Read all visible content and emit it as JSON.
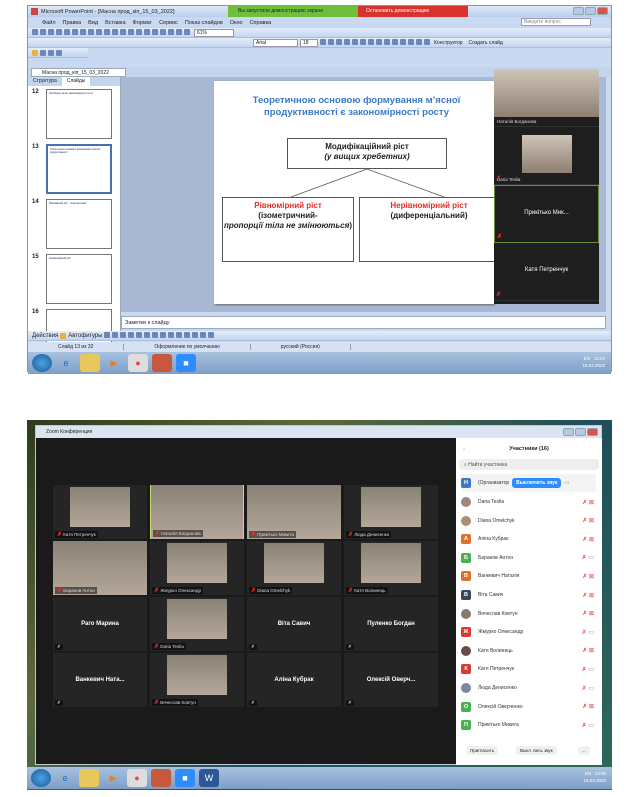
{
  "ppt": {
    "title": "Microsoft PowerPoint - [Масна прод_кіп_15_03_2022]",
    "share_notice": "Вы запустили демонстрацию экрана",
    "stop_share": "Остановить демонстрацию",
    "menu": [
      "Файл",
      "Правка",
      "Вид",
      "Вставка",
      "Формат",
      "Сервис",
      "Показ слайдов",
      "Окно",
      "Справка"
    ],
    "ask_placeholder": "Введите вопрос",
    "zoom_level": "61%",
    "font": "Arial",
    "font_size": "18",
    "designer": "Конструктор",
    "new_slide": "Создать слайд",
    "doc_tab": "Масна прод_кіп_15_03_2022",
    "pane_tabs": [
      "Структура",
      "Слайды"
    ],
    "thumbs": [
      {
        "num": "12",
        "text": "Необхідно знати закономірності росту"
      },
      {
        "num": "13",
        "text": "Теоретичною основою формування м'ясної продуктивності"
      },
      {
        "num": "14",
        "text": "Рівномірний ріст - ізометричний"
      },
      {
        "num": "15",
        "text": "Нерівномірний ріст"
      },
      {
        "num": "16",
        "text": ""
      }
    ],
    "slide": {
      "title": "Теоретичною основою формування м’ясної продуктивності є закономірності росту",
      "top_line1": "Модифікаційний ріст",
      "top_line2": "(у вищих хребетних)",
      "left_head": "Рівномірний ріст",
      "left_body1": "(ізометричний-",
      "left_body2": "пропорції тіла не змінюються",
      "left_body3": ")",
      "right_head": "Нерівномірний ріст",
      "right_body": "(диференціальний)"
    },
    "side_videos": [
      {
        "name": "Наталія Богданова",
        "photo": true
      },
      {
        "name": "Daria Teslia",
        "photo": true
      },
      {
        "name": "Прикітько Мик...",
        "photo": false
      },
      {
        "name": "Катя Петренчук",
        "photo": false
      }
    ],
    "notes": "Заметки к слайду",
    "actions": "Действия",
    "autoshapes": "Автофигуры",
    "status": [
      "Слайд 13 из 32",
      "Оформление по умолчанию",
      "русский (Россия)"
    ],
    "tray_lang": "EN",
    "time": "13:04",
    "date": "15.03.2022"
  },
  "zoom": {
    "title": "Zoom Конференция",
    "participants_title": "Участники (16)",
    "search_placeholder": "Найти участника",
    "grid": [
      {
        "name": "Катя Петренчук",
        "photo": true
      },
      {
        "name": "Наталія Богданова",
        "photo": true,
        "active": true
      },
      {
        "name": "Прикітько Микита",
        "photo": true
      },
      {
        "name": "Люда Денисенко",
        "photo": true
      },
      {
        "name": "Баранов Антон",
        "photo": true
      },
      {
        "name": "Жмурко Олександр",
        "photo": true
      },
      {
        "name": "Diana Omelchyk",
        "photo": true
      },
      {
        "name": "Катя Волинець",
        "photo": true
      },
      {
        "name": "Раго Марина",
        "photo": false
      },
      {
        "name": "Daria Teslia",
        "photo": true
      },
      {
        "name": "Віта Савич",
        "photo": false
      },
      {
        "name": "Пуленко Богдан",
        "photo": false
      },
      {
        "name": "Ванкевич Ната...",
        "photo": false
      },
      {
        "name": "Вячеслав Ковтун",
        "photo": true
      },
      {
        "name": "Аліна Кубрак",
        "photo": false
      },
      {
        "name": "Олексій Оверч...",
        "photo": false
      }
    ],
    "host": {
      "initial": "Н",
      "label": "(Организатор",
      "unmute": "Выключить звук"
    },
    "participants": [
      {
        "name": "Daria Teslia",
        "initial": "",
        "color": "#a08878",
        "video_off": true
      },
      {
        "name": "Diana Omelchyk",
        "initial": "",
        "color": "#a89070",
        "video_off": true
      },
      {
        "name": "Аліна Кубрак",
        "initial": "А",
        "color": "#e0712c",
        "video_off": true
      },
      {
        "name": "Баранов Антон",
        "initial": "Б",
        "color": "#4caf50",
        "video_off": false
      },
      {
        "name": "Ванкевич Наталія",
        "initial": "В",
        "color": "#e0712c",
        "video_off": true
      },
      {
        "name": "Віта Савич",
        "initial": "В",
        "color": "#34495e",
        "video_off": true
      },
      {
        "name": "Вячеслав Ковтун",
        "initial": "",
        "color": "#8a7a6a",
        "video_off": true
      },
      {
        "name": "Жмурко Олександр",
        "initial": "Ж",
        "color": "#d63c2f",
        "video_off": false
      },
      {
        "name": "Катя Волинець",
        "initial": "",
        "color": "#6a4a4a",
        "video_off": true
      },
      {
        "name": "Катя Петренчук",
        "initial": "К",
        "color": "#d63c2f",
        "video_off": false
      },
      {
        "name": "Люда Денисенко",
        "initial": "",
        "color": "#7a8a9a",
        "video_off": false
      },
      {
        "name": "Олексій Оверченко",
        "initial": "О",
        "color": "#4caf50",
        "video_off": true
      },
      {
        "name": "Прикітько Микита",
        "initial": "П",
        "color": "#4caf50",
        "video_off": false
      }
    ],
    "invite": "Пригласить",
    "mute_all": "Выкл. весь звук",
    "more": "...",
    "tray_lang": "EN",
    "time": "13:05",
    "date": "15.03.2022"
  }
}
